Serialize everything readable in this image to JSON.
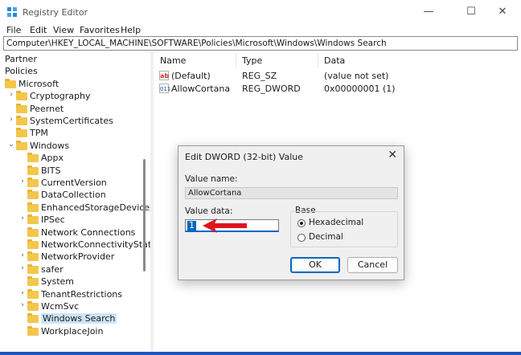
{
  "window": {
    "title": "Registry Editor",
    "minimize": "—",
    "maximize": "☐",
    "close": "✕"
  },
  "menu": [
    "File",
    "Edit",
    "View",
    "Favorites",
    "Help"
  ],
  "address": "Computer\\HKEY_LOCAL_MACHINE\\SOFTWARE\\Policies\\Microsoft\\Windows\\Windows Search",
  "tree": [
    {
      "label": "Partner",
      "level": 0,
      "expander": "",
      "folder": false
    },
    {
      "label": "Policies",
      "level": 0,
      "expander": "",
      "folder": false
    },
    {
      "label": "Microsoft",
      "level": 0,
      "expander": "",
      "folder": true
    },
    {
      "label": "Cryptography",
      "level": 1,
      "expander": "›",
      "folder": true
    },
    {
      "label": "Peernet",
      "level": 1,
      "expander": "",
      "folder": true
    },
    {
      "label": "SystemCertificates",
      "level": 1,
      "expander": "›",
      "folder": true
    },
    {
      "label": "TPM",
      "level": 1,
      "expander": "",
      "folder": true
    },
    {
      "label": "Windows",
      "level": 1,
      "expander": "⌄",
      "folder": true
    },
    {
      "label": "Appx",
      "level": 2,
      "expander": "",
      "folder": true
    },
    {
      "label": "BITS",
      "level": 2,
      "expander": "",
      "folder": true
    },
    {
      "label": "CurrentVersion",
      "level": 2,
      "expander": "›",
      "folder": true
    },
    {
      "label": "DataCollection",
      "level": 2,
      "expander": "",
      "folder": true
    },
    {
      "label": "EnhancedStorageDevices",
      "level": 2,
      "expander": "",
      "folder": true
    },
    {
      "label": "IPSec",
      "level": 2,
      "expander": "›",
      "folder": true
    },
    {
      "label": "Network Connections",
      "level": 2,
      "expander": "",
      "folder": true
    },
    {
      "label": "NetworkConnectivityStatus",
      "level": 2,
      "expander": "",
      "folder": true
    },
    {
      "label": "NetworkProvider",
      "level": 2,
      "expander": "›",
      "folder": true
    },
    {
      "label": "safer",
      "level": 2,
      "expander": "›",
      "folder": true
    },
    {
      "label": "System",
      "level": 2,
      "expander": "",
      "folder": true
    },
    {
      "label": "TenantRestrictions",
      "level": 2,
      "expander": "›",
      "folder": true
    },
    {
      "label": "WcmSvc",
      "level": 2,
      "expander": "›",
      "folder": true
    },
    {
      "label": "Windows Search",
      "level": 2,
      "expander": "",
      "folder": true,
      "selected": true
    },
    {
      "label": "WorkplaceJoin",
      "level": 2,
      "expander": "",
      "folder": true
    }
  ],
  "columns": {
    "name": "Name",
    "type": "Type",
    "data": "Data"
  },
  "values": [
    {
      "icon": "ab",
      "kind": "sz",
      "name": "(Default)",
      "type": "REG_SZ",
      "data": "(value not set)"
    },
    {
      "icon": "011",
      "kind": "dw",
      "name": "AllowCortana",
      "type": "REG_DWORD",
      "data": "0x00000001 (1)"
    }
  ],
  "dialog": {
    "title": "Edit DWORD (32-bit) Value",
    "close": "✕",
    "value_name_label": "Value name:",
    "value_name": "AllowCortana",
    "value_data_label": "Value data:",
    "value_data": "1",
    "base_label": "Base",
    "hex_label": "Hexadecimal",
    "dec_label": "Decimal",
    "ok_label": "OK",
    "cancel_label": "Cancel"
  },
  "colors": {
    "accent": "#0067c0",
    "arrow": "#e0141b",
    "folder": "#f3c74c",
    "selection": "#cce4f7"
  }
}
